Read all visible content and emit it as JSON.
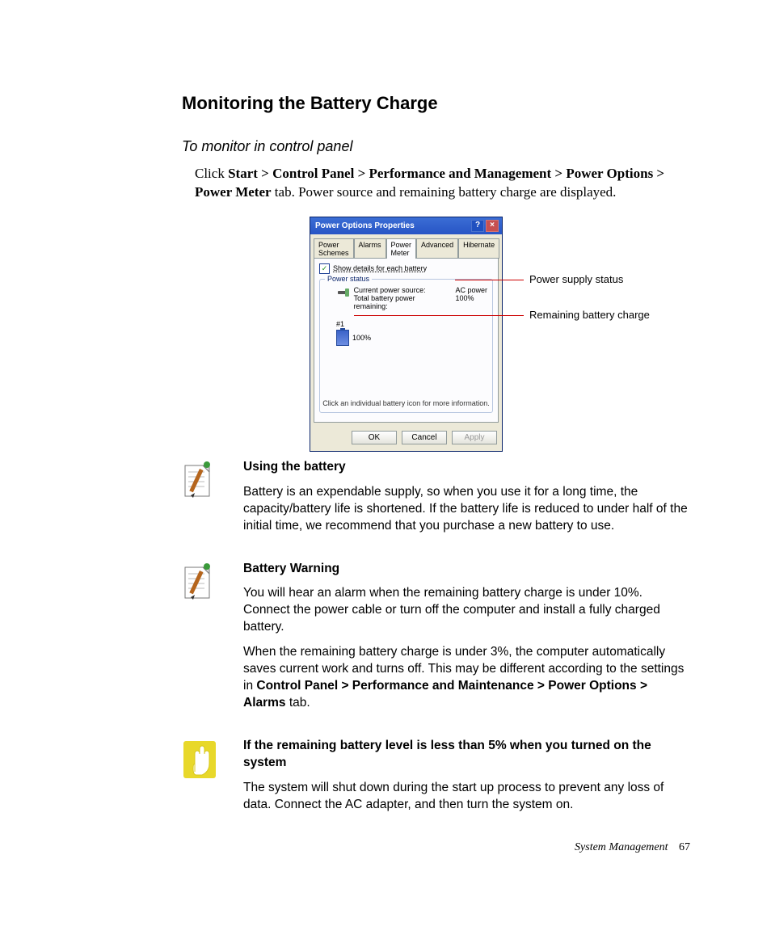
{
  "heading": "Monitoring the Battery Charge",
  "subheading": "To monitor in control panel",
  "intro": {
    "prefix": "Click ",
    "path": "Start > Control Panel > Performance and Management > Power Options > Power Meter",
    "suffix": " tab. Power source and remaining battery charge are displayed."
  },
  "dialog": {
    "title": "Power Options Properties",
    "tabs": [
      "Power Schemes",
      "Alarms",
      "Power Meter",
      "Advanced",
      "Hibernate"
    ],
    "active_tab_index": 2,
    "checkbox_label": "Show details for each battery",
    "groupbox_legend": "Power status",
    "current_source_label": "Current power source:",
    "current_source_value": "AC power",
    "total_remaining_label": "Total battery power remaining:",
    "total_remaining_value": "100%",
    "battery_number_label": "#1",
    "battery_percent": "100%",
    "hint": "Click an individual battery icon for more information.",
    "buttons": {
      "ok": "OK",
      "cancel": "Cancel",
      "apply": "Apply"
    }
  },
  "callouts": {
    "power_supply": "Power supply status",
    "remaining": "Remaining battery charge"
  },
  "notes": {
    "using_battery": {
      "title": "Using the battery",
      "body": "Battery is an expendable supply, so when you use it for a long time, the capacity/battery life is shortened. If the battery life is reduced to under half of the initial time, we recommend that you purchase a new battery to use."
    },
    "battery_warning": {
      "title": "Battery Warning",
      "p1": "You will hear an alarm when the remaining battery charge is under 10%. Connect the power cable or turn off the computer and install a fully charged battery.",
      "p2_a": "When the remaining battery charge is under 3%, the computer automatically saves current work and turns off. This may be different according to the settings in ",
      "p2_bold": "Control Panel > Performance and Maintenance > Power Options > Alarms",
      "p2_b": " tab."
    },
    "caution": {
      "title": "If the remaining battery level is less than 5% when you turned on the system",
      "body": "The system will shut down during the start up process to prevent any loss of data. Connect the AC adapter, and then turn the system on."
    }
  },
  "footer": {
    "section": "System Management",
    "page": "67"
  }
}
